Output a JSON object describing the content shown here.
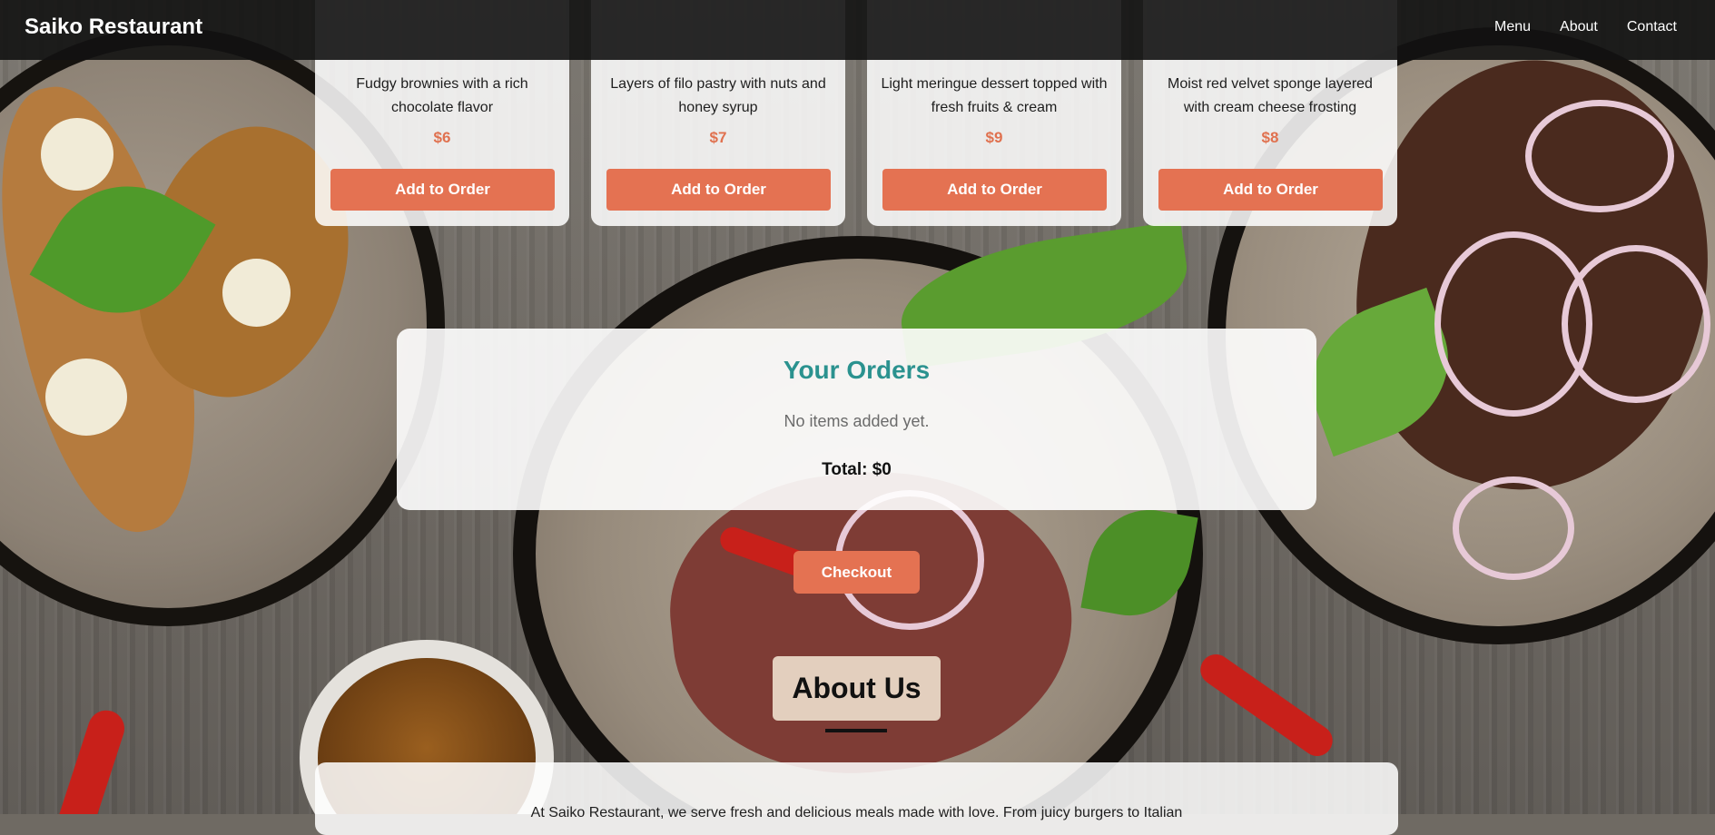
{
  "header": {
    "brand": "Saiko Restaurant",
    "nav": [
      "Menu",
      "About",
      "Contact"
    ]
  },
  "menu_cards": [
    {
      "description": "Fudgy brownies with a rich chocolate flavor",
      "price": "$6",
      "button": "Add to Order"
    },
    {
      "description": "Layers of filo pastry with nuts and honey syrup",
      "price": "$7",
      "button": "Add to Order"
    },
    {
      "description": "Light meringue dessert topped with fresh fruits & cream",
      "price": "$9",
      "button": "Add to Order"
    },
    {
      "description": "Moist red velvet sponge layered with cream cheese frosting",
      "price": "$8",
      "button": "Add to Order"
    }
  ],
  "orders": {
    "title": "Your Orders",
    "empty_message": "No items added yet.",
    "total": "Total: $0"
  },
  "checkout": {
    "label": "Checkout"
  },
  "about": {
    "title": "About Us",
    "text": "At Saiko Restaurant, we serve fresh and delicious meals made with love. From juicy burgers to Italian"
  },
  "colors": {
    "accent": "#e47252",
    "orders_title": "#2b928f",
    "header_bg": "#121212"
  }
}
